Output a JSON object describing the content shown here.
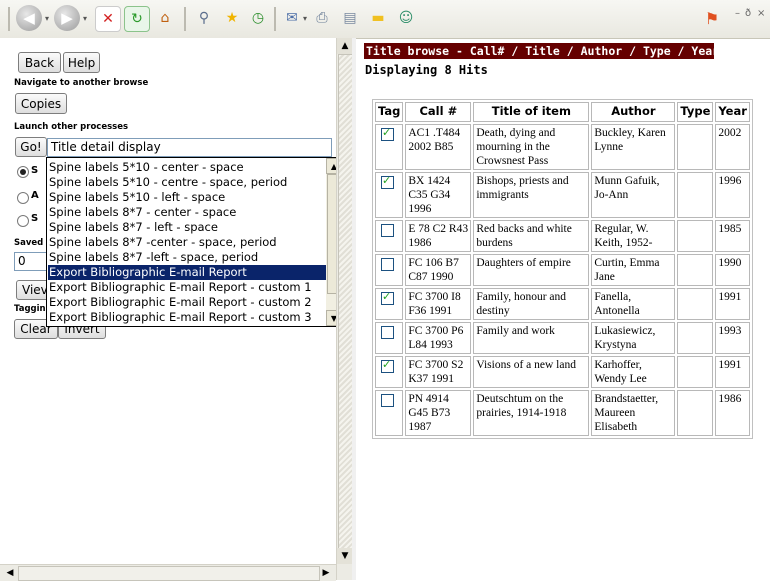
{
  "colors": {
    "title_bar": "#650000",
    "selected_option": "#0a246a"
  },
  "left": {
    "back_label": "Back",
    "help_label": "Help",
    "navigate_label": "Navigate to another browse",
    "copies_label": "Copies",
    "launch_label": "Launch other processes",
    "go_label": "Go!",
    "process_select_value": "Title detail display",
    "radio_partial": [
      "S",
      "A",
      "S"
    ],
    "saved_partial": "Saved",
    "saved_input_value": "0",
    "view_partial": "Viev",
    "tagging_partial": "Taggin",
    "clear_label": "Clear",
    "invert_label": "Invert"
  },
  "dropdown": {
    "options": [
      "Spine labels 5*10 - center - space",
      "Spine labels 5*10 - centre - space, period",
      "Spine labels 5*10 - left - space",
      "Spine labels 8*7 - center - space",
      "Spine labels 8*7 - left - space",
      "Spine labels 8*7 -center - space, period",
      "Spine labels 8*7 -left - space, period",
      "Export Bibliographic E-mail Report",
      "Export Bibliographic E-mail Report - custom 1",
      "Export Bibliographic E-mail Report - custom 2",
      "Export Bibliographic E-mail Report - custom 3"
    ],
    "selected_index": 7
  },
  "right": {
    "title": "Title browse - Call# / Title / Author / Type / Year",
    "hits": "Displaying 8 Hits",
    "columns": [
      "Tag",
      "Call #",
      "Title of item",
      "Author",
      "Type",
      "Year"
    ],
    "rows": [
      {
        "tagged": true,
        "call": "AC1 .T484 2002 B85",
        "title": "Death, dying and mourning in the Crowsnest Pass",
        "author": "Buckley, Karen Lynne",
        "type": "",
        "year": "2002"
      },
      {
        "tagged": true,
        "call": "BX 1424 C35 G34 1996",
        "title": "Bishops, priests and immigrants",
        "author": "Munn Gafuik, Jo-Ann",
        "type": "",
        "year": "1996"
      },
      {
        "tagged": false,
        "call": "E 78 C2 R43 1986",
        "title": "Red backs and white burdens",
        "author": "Regular, W. Keith, 1952-",
        "type": "",
        "year": "1985"
      },
      {
        "tagged": false,
        "call": "FC 106 B7 C87 1990",
        "title": "Daughters of empire",
        "author": "Curtin, Emma Jane",
        "type": "",
        "year": "1990"
      },
      {
        "tagged": true,
        "call": "FC 3700 I8 F36 1991",
        "title": "Family, honour and destiny",
        "author": "Fanella, Antonella",
        "type": "",
        "year": "1991"
      },
      {
        "tagged": false,
        "call": "FC 3700 P6 L84 1993",
        "title": "Family and work",
        "author": "Lukasiewicz, Krystyna",
        "type": "",
        "year": "1993"
      },
      {
        "tagged": true,
        "call": "FC 3700 S2 K37 1991",
        "title": "Visions of a new land",
        "author": "Karhoffer, Wendy Lee",
        "type": "",
        "year": "1991"
      },
      {
        "tagged": false,
        "call": "PN 4914 G45 B73 1987",
        "title": "Deutschtum on the prairies, 1914-1918",
        "author": "Brandstaetter, Maureen Elisabeth",
        "type": "",
        "year": "1986"
      }
    ]
  },
  "window_controls": [
    "–",
    "ð",
    "×"
  ],
  "toolbar": {
    "icons": [
      "back-icon",
      "forward-icon",
      "stop-icon",
      "refresh-icon",
      "home-icon",
      "search-icon",
      "favorites-icon",
      "history-icon",
      "mail-icon",
      "print-icon",
      "edit-icon",
      "folder-icon",
      "messenger-icon",
      "windows-logo-icon"
    ]
  }
}
